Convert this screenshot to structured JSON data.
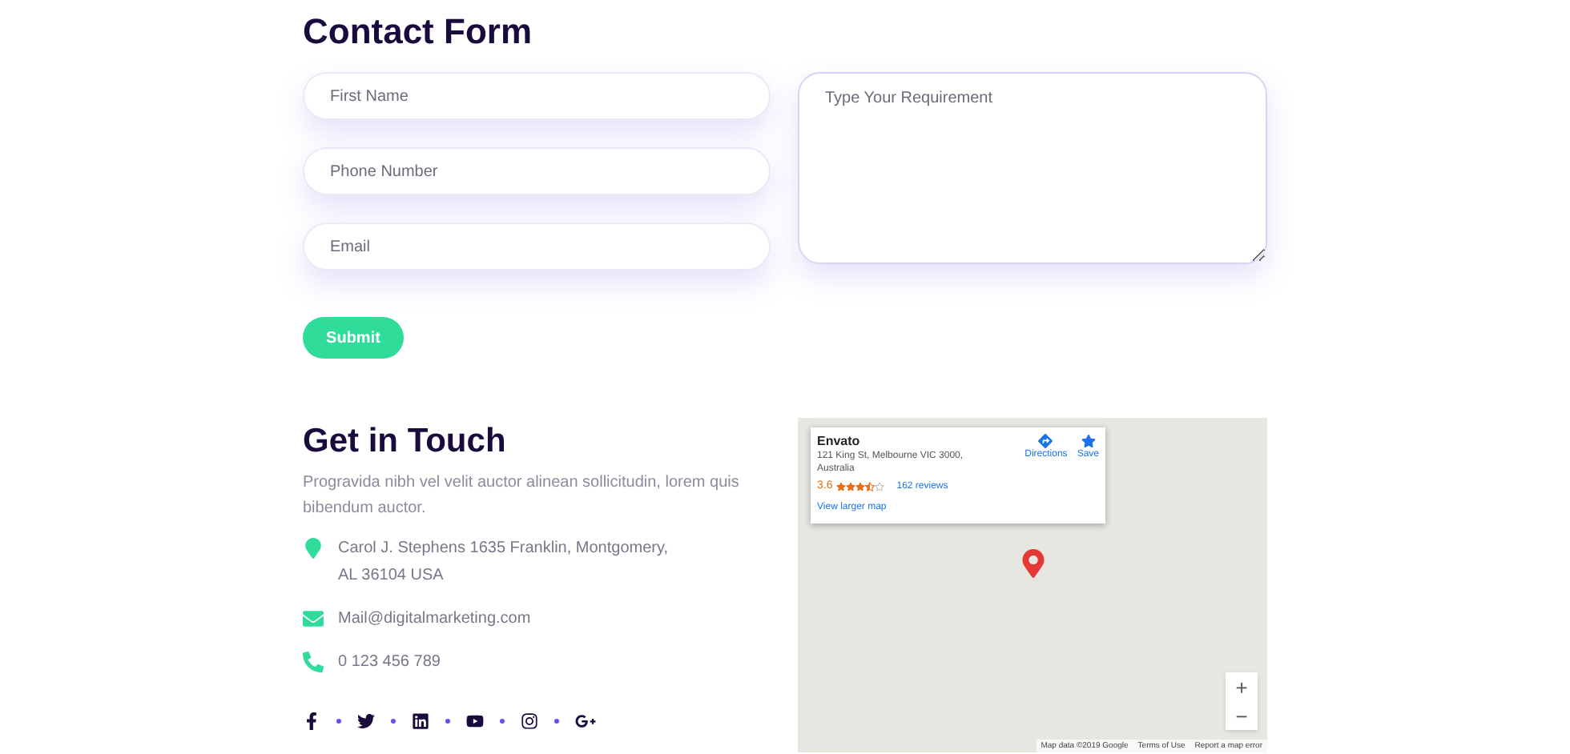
{
  "contact_form": {
    "title": "Contact Form",
    "fields": [
      {
        "placeholder": "First Name"
      },
      {
        "placeholder": "Phone Number"
      },
      {
        "placeholder": "Email"
      }
    ],
    "message": {
      "placeholder": "Type Your Requirement"
    },
    "submit": "Submit"
  },
  "get_in_touch": {
    "title": "Get in Touch",
    "description": "Progravida nibh vel velit auctor alinean sollicitudin, lorem quis bibendum auctor.",
    "contacts": [
      {
        "kind": "address",
        "text": "Carol J. Stephens 1635 Franklin, Montgomery, AL 36104 USA"
      },
      {
        "kind": "email",
        "text": "Mail@digitalmarketing.com"
      },
      {
        "kind": "phone",
        "text": "0 123 456 789"
      }
    ],
    "social": [
      {
        "kind": "facebook"
      },
      {
        "kind": "twitter"
      },
      {
        "kind": "linkedin"
      },
      {
        "kind": "youtube"
      },
      {
        "kind": "instagram"
      },
      {
        "kind": "google"
      }
    ]
  },
  "map": {
    "place": {
      "name": "Envato",
      "address": "121 King St, Melbourne VIC 3000, Australia",
      "rating": "3.6",
      "stars": 3.5,
      "reviews": "162 reviews",
      "larger_map": "View larger map",
      "directions": "Directions",
      "save": "Save"
    },
    "zoom_in": "+",
    "zoom_out": "−",
    "attribution": "Map data ©2019 Google",
    "terms": "Terms of Use",
    "report": "Report a map error"
  }
}
